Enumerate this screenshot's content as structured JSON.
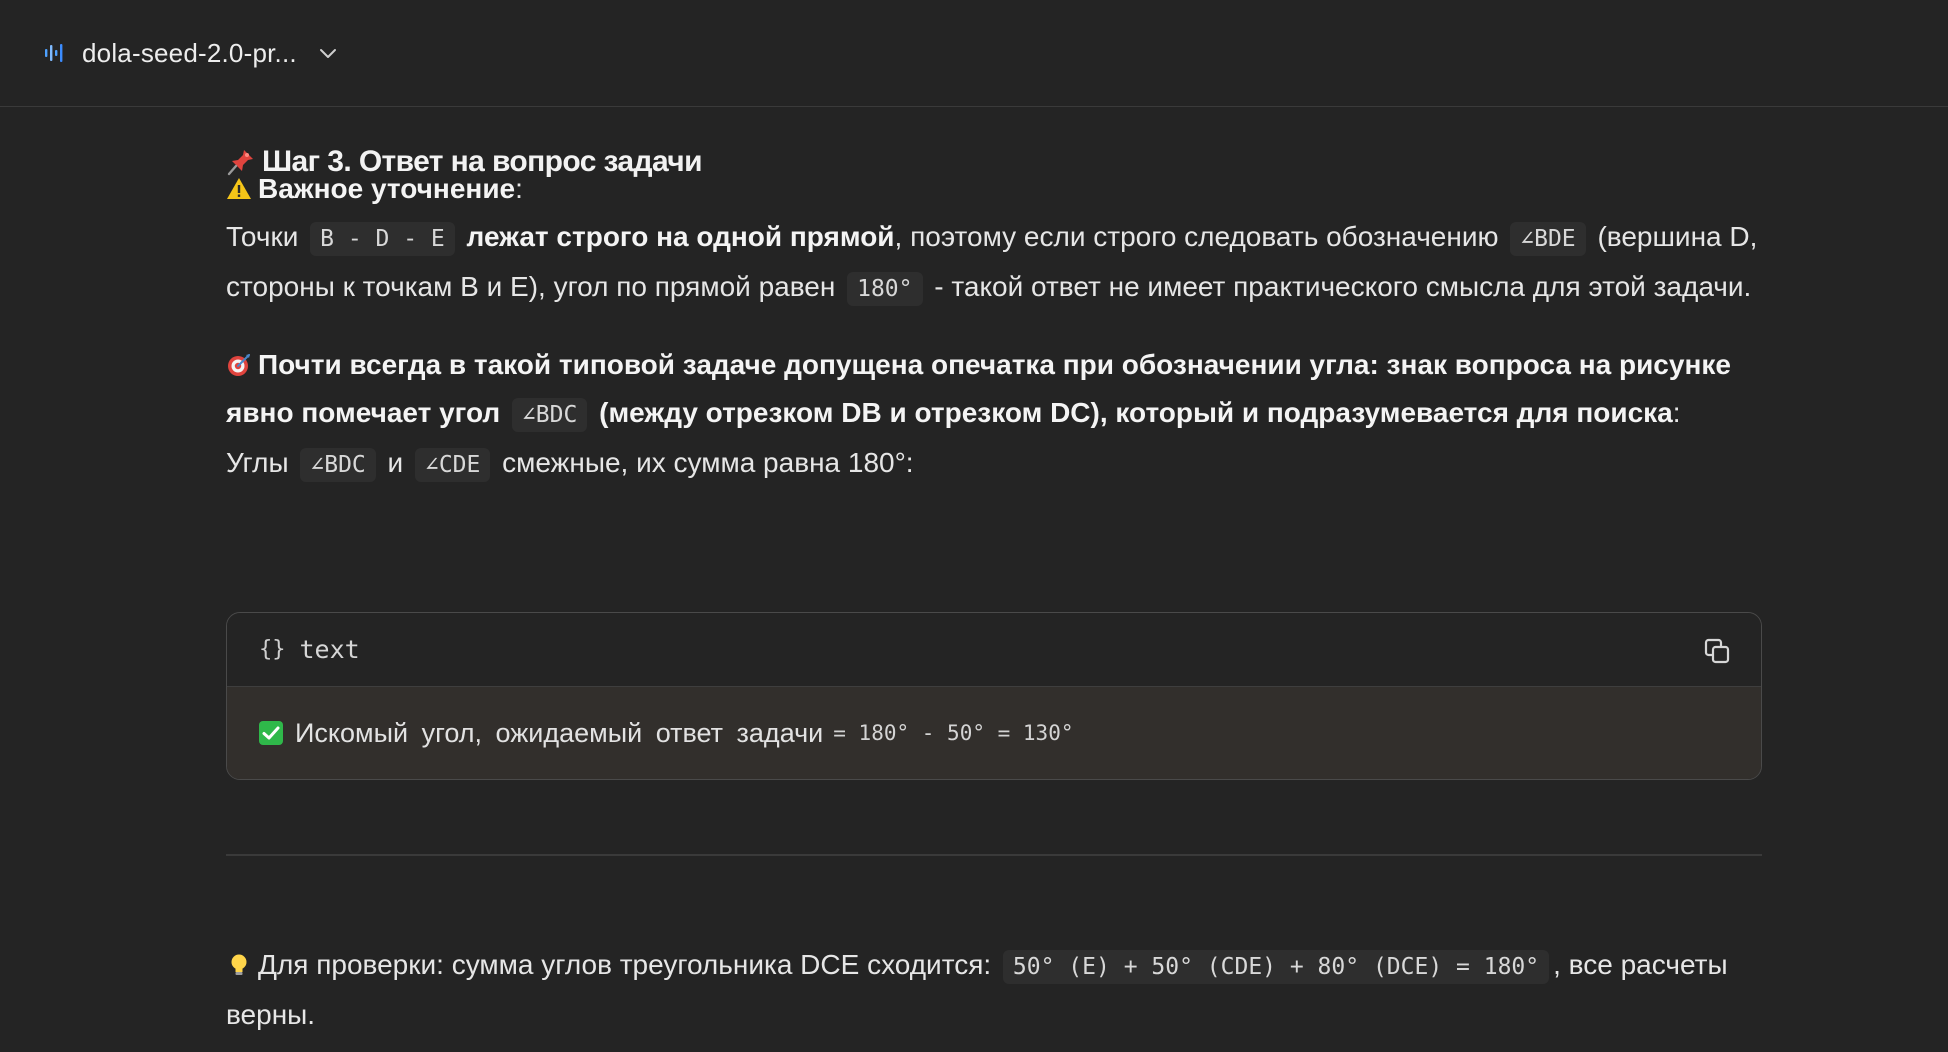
{
  "header": {
    "model_name": "dola-seed-2.0-pr..."
  },
  "step": {
    "title": "Шаг 3. Ответ на вопрос задачи"
  },
  "note": {
    "label": "Важное уточнение",
    "label_suffix": ":",
    "t1": "Точки",
    "code1": "B - D - E",
    "bold1": "лежат строго на одной прямой",
    "t2": ", поэтому если строго следовать обозначению",
    "code2": "∠BDE",
    "t3": "(вершина D, стороны к точкам B и E), угол по прямой равен",
    "code3": "180°",
    "t4": "- такой ответ не имеет практического смысла для этой задачи."
  },
  "hint": {
    "bold1": "Почти всегда в такой типовой задаче допущена опечатка при обозначении угла: знак вопроса на рисунке явно помечает угол",
    "code1": "∠BDC",
    "bold2": "(между отрезком DB и отрезком DC), который и подразумевается для поиска",
    "t1": ":",
    "t2": "Углы",
    "code2": "∠BDC",
    "t3": "и",
    "code3": "∠CDE",
    "t4": "смежные, их сумма равна 180°:"
  },
  "codeblock": {
    "brace": "{}",
    "language": "text",
    "line_text": "Искомый угол, ожидаемый ответ задачи",
    "line_formula": "= 180° - 50° = 130°"
  },
  "check": {
    "t1": "Для проверки: сумма углов треугольника DCE сходится:",
    "code1": "50° (E) + 50° (CDE) + 80° (DCE) = 180°",
    "t2": ", все расчеты верны."
  },
  "colors": {
    "background": "#242424",
    "text": "#e6e6e6",
    "code_bg": "#2e2e2e",
    "accent_blue": "#4ea1ff"
  }
}
